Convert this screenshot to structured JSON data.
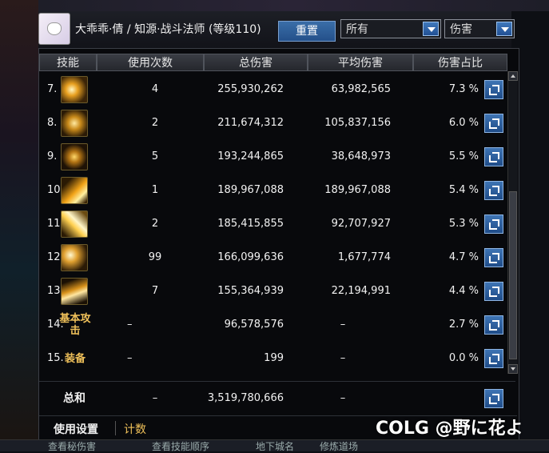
{
  "header": {
    "character": "大乖乖·倩 / 知源·战斗法师 (等级110)",
    "reset_label": "重置",
    "filter_select": "所有",
    "type_select": "伤害"
  },
  "table": {
    "columns": [
      "技能",
      "使用次数",
      "总伤害",
      "平均伤害",
      "伤害占比"
    ],
    "rows": [
      {
        "rank": "7.",
        "icon": "skill-7-icon",
        "count": "4",
        "total": "255,930,262",
        "avg": "63,982,565",
        "pct": "7.3 %"
      },
      {
        "rank": "8.",
        "icon": "skill-8-icon",
        "count": "2",
        "total": "211,674,312",
        "avg": "105,837,156",
        "pct": "6.0 %"
      },
      {
        "rank": "9.",
        "icon": "skill-9-icon",
        "count": "5",
        "total": "193,244,865",
        "avg": "38,648,973",
        "pct": "5.5 %"
      },
      {
        "rank": "10.",
        "icon": "skill-10-icon",
        "count": "1",
        "total": "189,967,088",
        "avg": "189,967,088",
        "pct": "5.4 %"
      },
      {
        "rank": "11.",
        "icon": "skill-11-icon",
        "count": "2",
        "total": "185,415,855",
        "avg": "92,707,927",
        "pct": "5.3 %"
      },
      {
        "rank": "12.",
        "icon": "skill-12-icon",
        "count": "99",
        "total": "166,099,636",
        "avg": "1,677,774",
        "pct": "4.7 %"
      },
      {
        "rank": "13.",
        "icon": "skill-13-icon",
        "count": "7",
        "total": "155,364,939",
        "avg": "22,194,991",
        "pct": "4.4 %"
      },
      {
        "rank": "14.",
        "skill_text": "基本攻击",
        "count": "–",
        "total": "96,578,576",
        "avg": "–",
        "pct": "2.7 %"
      },
      {
        "rank": "15.",
        "skill_text": "装备",
        "count": "–",
        "total": "199",
        "avg": "–",
        "pct": "0.0 %"
      }
    ],
    "total": {
      "label": "总和",
      "count": "–",
      "total": "3,519,780,666",
      "avg": "–"
    }
  },
  "footer": {
    "settings_tab": "使用设置",
    "count_tab": "计数"
  },
  "bottom_bar": {
    "left": "查看秘伤害",
    "mid": "查看技能顺序",
    "right": "地下城名",
    "far": "修炼道场"
  },
  "watermark": "COLG @野に花よ",
  "colors": {
    "accent_gold": "#f0c15a",
    "button_blue": "#2a5d9c"
  }
}
